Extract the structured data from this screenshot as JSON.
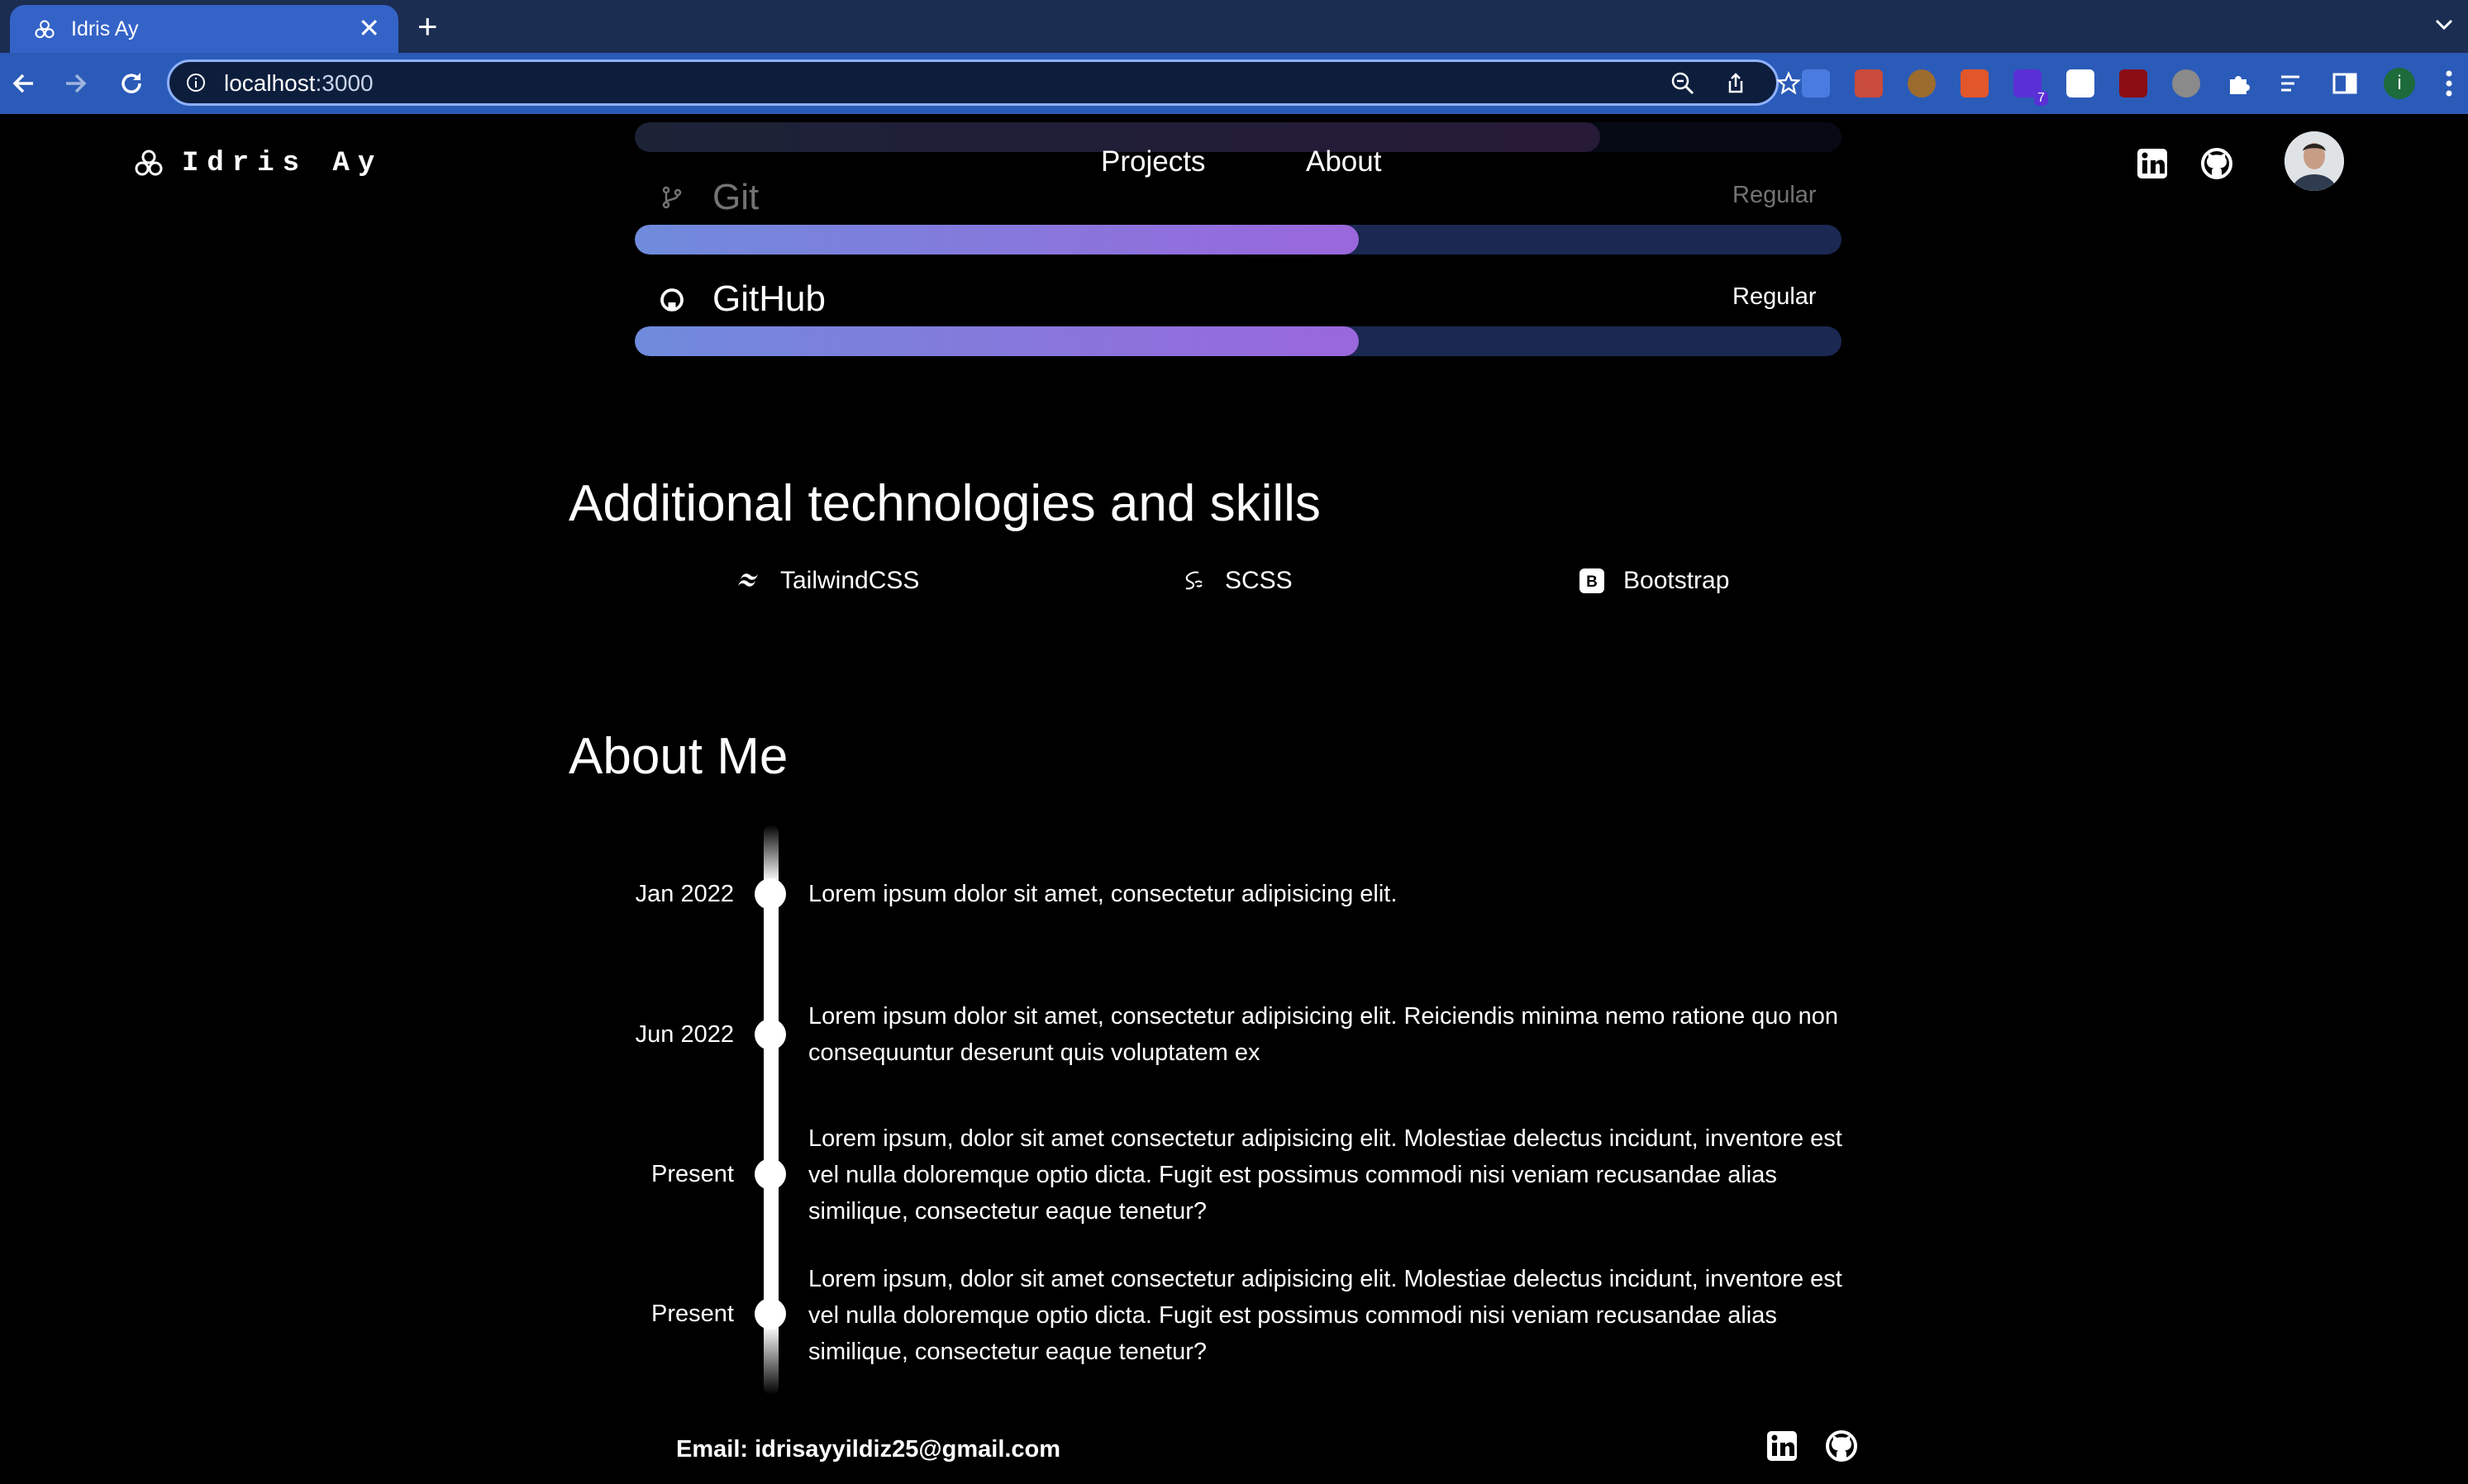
{
  "browser": {
    "tab_title": "Idris Ay",
    "url_host": "localhost",
    "url_port": ":3000",
    "extension_badge": "7",
    "profile_initial": "i"
  },
  "header": {
    "brand": "Idris Ay",
    "nav": [
      "Projects",
      "About"
    ]
  },
  "skills": [
    {
      "name": "Git",
      "level": "Regular",
      "progress": 0.6
    },
    {
      "name": "GitHub",
      "level": "Regular",
      "progress": 0.6
    }
  ],
  "additional": {
    "title": "Additional technologies and skills",
    "items": [
      {
        "name": "TailwindCSS",
        "icon": "tailwind-icon"
      },
      {
        "name": "SCSS",
        "icon": "sass-icon"
      },
      {
        "name": "Bootstrap",
        "icon": "bootstrap-icon"
      }
    ]
  },
  "about": {
    "title": "About Me",
    "timeline": [
      {
        "date": "Jan 2022",
        "text": "Lorem ipsum dolor sit amet, consectetur adipisicing elit."
      },
      {
        "date": "Jun 2022",
        "text": "Lorem ipsum dolor sit amet, consectetur adipisicing elit. Reiciendis minima nemo ratione quo non consequuntur deserunt quis voluptatem ex"
      },
      {
        "date": "Present",
        "text": "Lorem ipsum, dolor sit amet consectetur adipisicing elit. Molestiae delectus incidunt, inventore est vel nulla doloremque optio dicta. Fugit est possimus commodi nisi veniam recusandae alias similique, consectetur eaque tenetur?"
      },
      {
        "date": "Present",
        "text": "Lorem ipsum, dolor sit amet consectetur adipisicing elit. Molestiae delectus incidunt, inventore est vel nulla doloremque optio dicta. Fugit est possimus commodi nisi veniam recusandae alias similique, consectetur eaque tenetur?"
      }
    ]
  },
  "footer": {
    "email": "Email: idrisayyildiz25@gmail.com"
  },
  "colors": {
    "tab_active": "#3463c8",
    "toolbar": "#2b5bb8",
    "bar_track": "#1b2852",
    "bar_start": "#6f8bdc",
    "bar_end": "#9a67dc"
  }
}
